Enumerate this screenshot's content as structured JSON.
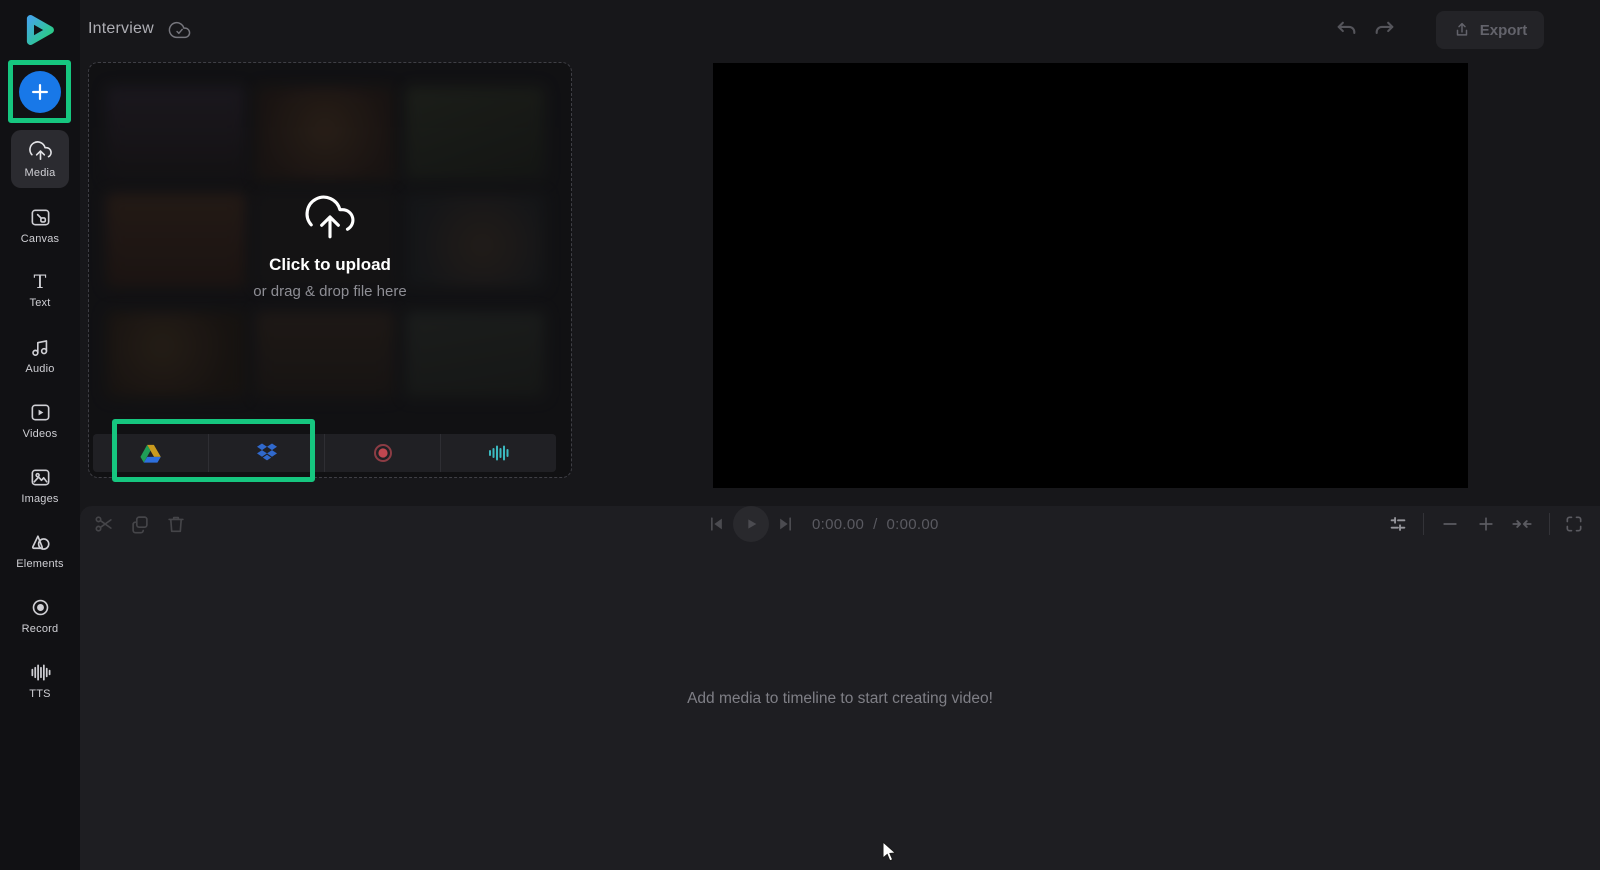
{
  "topbar": {
    "title": "Interview",
    "saved_status_icon": "cloud-check-icon",
    "undo_icon": "undo-icon",
    "redo_icon": "redo-icon",
    "export": {
      "label": "Export",
      "icon": "upload-icon"
    }
  },
  "sidebar": {
    "add_button_icon": "plus-icon",
    "items": [
      {
        "label": "Media",
        "icon": "cloud-upload-icon",
        "active": true
      },
      {
        "label": "Canvas",
        "icon": "canvas-icon"
      },
      {
        "label": "Text",
        "icon": "text-icon",
        "glyph": "T"
      },
      {
        "label": "Audio",
        "icon": "music-note-icon"
      },
      {
        "label": "Videos",
        "icon": "video-icon"
      },
      {
        "label": "Images",
        "icon": "image-icon"
      },
      {
        "label": "Elements",
        "icon": "shapes-icon"
      },
      {
        "label": "Record",
        "icon": "record-icon"
      },
      {
        "label": "TTS",
        "icon": "waveform-icon"
      }
    ]
  },
  "media_panel": {
    "upload_title": "Click to upload",
    "upload_subtitle": "or drag & drop file here",
    "upload_icon": "cloud-upload-icon",
    "integrations": [
      {
        "name": "google-drive-icon"
      },
      {
        "name": "dropbox-icon"
      },
      {
        "name": "record-icon"
      },
      {
        "name": "text-to-speech-icon"
      }
    ]
  },
  "timeline": {
    "tools": [
      "split-icon",
      "duplicate-icon",
      "delete-icon"
    ],
    "transport_icons": [
      "skip-to-start-icon",
      "play-icon",
      "skip-to-end-icon"
    ],
    "current_time": "0:00.00",
    "separator": "  /  ",
    "duration": "0:00.00",
    "zoom_icons": [
      "timeline-settings-icon",
      "zoom-out-icon",
      "zoom-in-icon",
      "fit-to-screen-icon",
      "fullscreen-icon"
    ],
    "empty_message": "Add media to timeline to start creating video!"
  },
  "highlights": {
    "annotation_color": "#16c67f"
  },
  "colors": {
    "accent_green": "#16c67f",
    "add_button_blue": "#1878e8",
    "record_red": "#bf4750",
    "tts_teal": "#3bbac1",
    "dropbox_blue": "#3069cd",
    "drive_green": "#1f9d57",
    "drive_yellow": "#c99a1e",
    "drive_blue": "#2d6fdd"
  }
}
